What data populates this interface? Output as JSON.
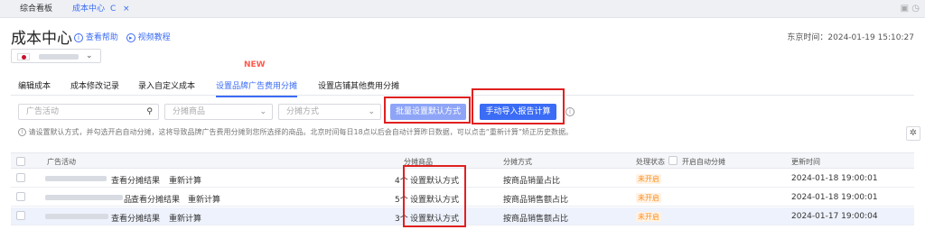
{
  "tabs": {
    "items": [
      "综合看板",
      "成本中心"
    ],
    "reload_icon": "C",
    "close_icon": "×"
  },
  "header": {
    "title": "成本中心",
    "help_link": "查看帮助",
    "video_link": "视频教程",
    "clock": "东京时间：2024-01-19 15:10:27"
  },
  "nav": {
    "new_badge": "NEW",
    "items": [
      "编辑成本",
      "成本修改记录",
      "录入自定义成本",
      "设置品牌广告费用分摊",
      "设置店铺其他费用分摊"
    ]
  },
  "filters": {
    "campaign_placeholder": "广告活动",
    "product_placeholder": "分摊商品",
    "method_placeholder": "分摊方式",
    "batch_button": "批量设置默认方式",
    "import_button": "手动导入报告计算"
  },
  "info_text": "请设置默认方式，并勾选开启自动分摊，这将导致品牌广告费用分摊到您所选择的商品。北京时间每日18点以后会自动计算昨日数据，可以点击“重新计算”矫正历史数据。",
  "table": {
    "headers": {
      "campaign": "广告活动",
      "product": "分摊商品",
      "method": "分摊方式",
      "status": "处理状态",
      "auto_toggle": "开启自动分摊",
      "updated": "更新时间"
    },
    "rows": [
      {
        "view_link": "查看分摊结果",
        "recalc_link": "重新计算",
        "count": "4个",
        "set_link": "设置默认方式",
        "method": "按商品销量占比",
        "status": "未开启",
        "updated": "2024-01-18 19:00:01"
      },
      {
        "view_link": "查看分摊结果",
        "recalc_link": "重新计算",
        "count": "5个",
        "set_link": "设置默认方式",
        "method": "按商品销售额占比",
        "status": "未开启",
        "updated": "2024-01-18 19:00:01"
      },
      {
        "view_link": "查看分摊结果",
        "recalc_link": "重新计算",
        "count": "3个",
        "set_link": "设置默认方式",
        "method": "按商品销售额占比",
        "status": "未开启",
        "updated": "2024-01-17 19:00:04"
      }
    ],
    "partial_char": "品"
  },
  "colors": {
    "accent": "#3b6cf5",
    "highlight": "#e02020",
    "status": "#ff8c1a"
  }
}
